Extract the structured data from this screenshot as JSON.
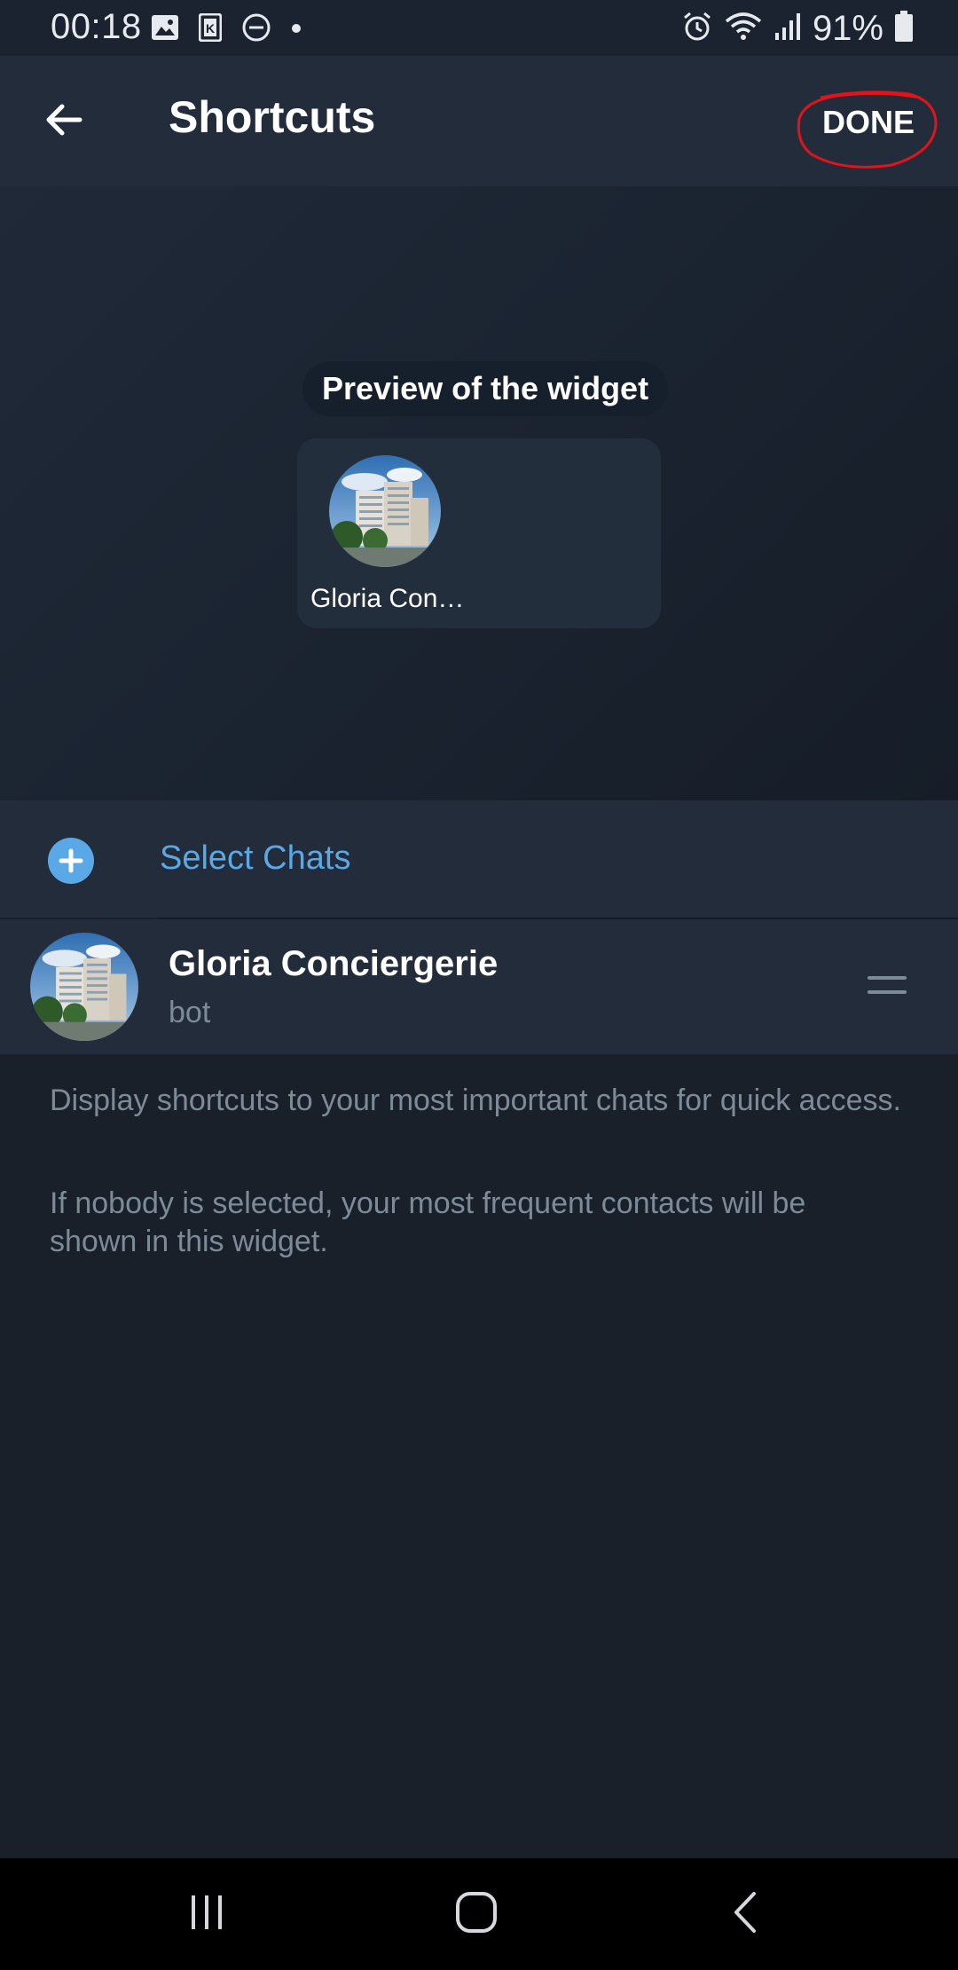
{
  "status_bar": {
    "time": "00:18",
    "battery": "91%",
    "left_icons": [
      "image-icon",
      "k-app-icon",
      "do-not-disturb-icon",
      "dot-icon"
    ],
    "right_icons": [
      "alarm-icon",
      "wifi-icon",
      "signal-icon",
      "battery-icon"
    ]
  },
  "toolbar": {
    "title": "Shortcuts",
    "done_label": "DONE",
    "back_icon": "arrow-left-icon"
  },
  "preview": {
    "caption": "Preview of the widget",
    "widget_label": "Gloria Con…"
  },
  "select_chats": {
    "label": "Select Chats",
    "icon": "plus-circle-icon"
  },
  "chat": {
    "name": "Gloria Conciergerie",
    "subtitle": "bot",
    "handle_icon": "drag-handle-icon"
  },
  "info": {
    "line1": "Display shortcuts to your most important chats for quick access.",
    "line2": "If nobody is selected, your most frequent contacts will be shown in this widget."
  },
  "colors": {
    "background": "#19202a",
    "toolbar": "#222c3a",
    "accent": "#5aa9e6",
    "secondary_text": "#7d8b99",
    "annotation": "#e0141a"
  },
  "nav_bar": {
    "recents_icon": "recents-icon",
    "home_icon": "home-icon",
    "back_icon": "back-chevron-icon"
  }
}
